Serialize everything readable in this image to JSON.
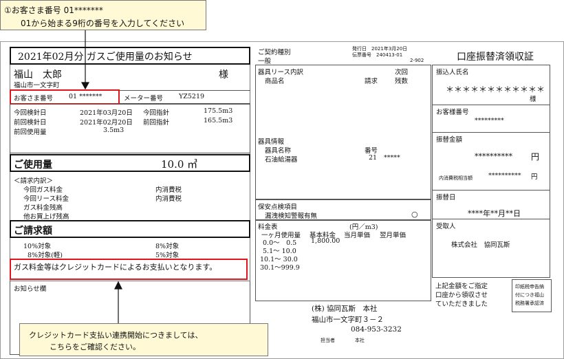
{
  "callout_top": {
    "line1": "①お客さま番号 01*******",
    "line2": "01から始まる9桁の番号を入力してください"
  },
  "callout_bottom": {
    "line1": "クレジットカード支払い連携開始につきましては、",
    "line2": "こちらをご確認ください。"
  },
  "left": {
    "title": "2021年02月分 ガスご使用量のお知らせ",
    "customer_name": "福山　太郎",
    "honorific": "様",
    "address": "福山市一文字町",
    "customer_no_label": "お客さま番号",
    "customer_no_value": "01 *******",
    "meter_label": "メーター番号",
    "meter_value": "YZ5219",
    "readings": [
      {
        "label": "今回検針日",
        "date": "2021年03月20日",
        "label2": "今回指針",
        "value": "175.5m3"
      },
      {
        "label": "前回検針日",
        "date": "2021年02月20日",
        "label2": "前回指針",
        "value": "165.5m3"
      }
    ],
    "prev_usage_label": "前回使用量",
    "prev_usage_value": "3.5m3",
    "usage_label": "ご使用量",
    "usage_value": "10.0 ㎥",
    "bill_header": "＜請求内訳＞",
    "bill_items": [
      {
        "label": "今回ガス料金",
        "tax": "内消費税"
      },
      {
        "label": "今回リース料金",
        "tax": "内消費税"
      },
      {
        "label": "ガス料金残高",
        "tax": ""
      },
      {
        "label": "他お買上げ残高",
        "tax": ""
      }
    ],
    "billing_amount_label": "ご請求額",
    "tax_rows": [
      {
        "label": "10%対象",
        "label2": "8%対象"
      },
      {
        "label": "8%対象(軽)",
        "label2": "5%対象"
      }
    ],
    "credit_notice": "ガス料金等はクレジットカードによるお支払いとなります。",
    "notice_label": "お知らせ欄"
  },
  "middle": {
    "contract_type_label": "ご契約種別",
    "contract_type_value": "一般",
    "issue_date": "発行日　2021年3月20日",
    "slip_no": "伝票番号　240413-01",
    "slip_sub": "2-902",
    "lease_header": "器具リース内訳",
    "lease_next": "次回",
    "lease_cols": [
      "商品名",
      "請求",
      "残数"
    ],
    "equip_header": "器具情報",
    "equip_cols": [
      "器具名称",
      "番号"
    ],
    "equip_row": {
      "name": "石油給湯器",
      "no": "21",
      "mask": "*****"
    },
    "safety_header": "保安点検項目",
    "safety_item": "漏洩検知警報有無",
    "safety_mark": "○",
    "rate_header": "料金表",
    "rate_unit": "(円／m3)",
    "rate_cols": [
      "一ヶ月使用量",
      "基本料金",
      "当月単価",
      "翌月単価"
    ],
    "rate_rows": [
      {
        "range": "0.0～　0.5",
        "base": "1,800.00"
      },
      {
        "range": "5.1～ 10.0",
        "base": ""
      },
      {
        "range": "10.1～ 30.0",
        "base": ""
      },
      {
        "range": "30.1～999.9",
        "base": ""
      }
    ],
    "company": "(株) 協同瓦斯　本社",
    "company_addr": "福山市一文字町３－２",
    "company_tel": "084-953-3232",
    "staff_label": "担当者",
    "staff_value": "本社"
  },
  "right": {
    "title": "口座振替済領収証",
    "payer_label": "振込人氏名",
    "payer_value": "＊＊＊＊＊＊＊＊＊＊＊＊",
    "payer_honorific": "様",
    "customer_no_label": "お客様番号",
    "customer_no_value": "*********",
    "amount_label": "振替金額",
    "amount_value": "**********",
    "amount_unit": "円",
    "tax_label": "内消費税相当額",
    "tax_value": "**********",
    "tax_unit": "円",
    "date_label": "振替日",
    "date_value": "****年**月**日",
    "receiver_label": "受取人",
    "receiver_value": "株式会社　協同瓦斯",
    "footer_lines": [
      "上記金額をご指定",
      "口座から領収させ",
      "ていただきました"
    ],
    "stamp_lines": [
      "印紙税申告納",
      "付につき福山",
      "税務署承認済"
    ]
  },
  "colors": {
    "callout_bg": "#fff9d6",
    "highlight": "#e0141b"
  }
}
